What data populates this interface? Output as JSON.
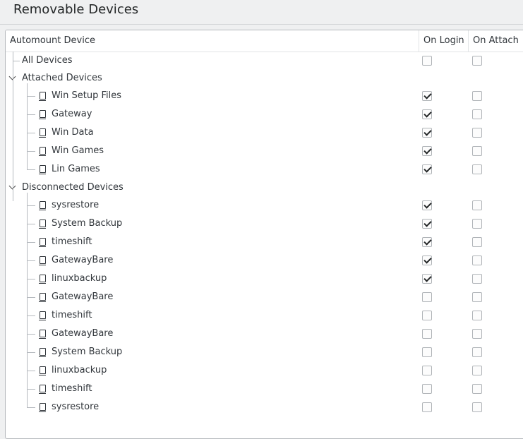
{
  "page": {
    "title": "Removable Devices"
  },
  "table": {
    "columns": {
      "device": "Automount Device",
      "on_login": "On Login",
      "on_attach": "On Attach"
    }
  },
  "tree": {
    "all_devices": {
      "label": "All Devices",
      "on_login": false,
      "on_attach": false
    },
    "attached_group": {
      "label": "Attached Devices",
      "expanded": true,
      "items": [
        {
          "label": "Win Setup Files",
          "on_login": true,
          "on_attach": false
        },
        {
          "label": "Gateway",
          "on_login": true,
          "on_attach": false
        },
        {
          "label": "Win Data",
          "on_login": true,
          "on_attach": false
        },
        {
          "label": "Win Games",
          "on_login": true,
          "on_attach": false
        },
        {
          "label": "Lin Games",
          "on_login": true,
          "on_attach": false
        }
      ]
    },
    "disconnected_group": {
      "label": "Disconnected Devices",
      "expanded": true,
      "items": [
        {
          "label": "sysrestore",
          "on_login": true,
          "on_attach": false
        },
        {
          "label": "System Backup",
          "on_login": true,
          "on_attach": false
        },
        {
          "label": "timeshift",
          "on_login": true,
          "on_attach": false
        },
        {
          "label": "GatewayBare",
          "on_login": true,
          "on_attach": false
        },
        {
          "label": "linuxbackup",
          "on_login": true,
          "on_attach": false
        },
        {
          "label": "GatewayBare",
          "on_login": false,
          "on_attach": false
        },
        {
          "label": "timeshift",
          "on_login": false,
          "on_attach": false
        },
        {
          "label": "GatewayBare",
          "on_login": false,
          "on_attach": false
        },
        {
          "label": "System Backup",
          "on_login": false,
          "on_attach": false
        },
        {
          "label": "linuxbackup",
          "on_login": false,
          "on_attach": false
        },
        {
          "label": "timeshift",
          "on_login": false,
          "on_attach": false
        },
        {
          "label": "sysrestore",
          "on_login": false,
          "on_attach": false
        }
      ]
    }
  },
  "icons": {
    "group_toggle": "chevron-down-icon",
    "device": "removable-drive-icon"
  }
}
